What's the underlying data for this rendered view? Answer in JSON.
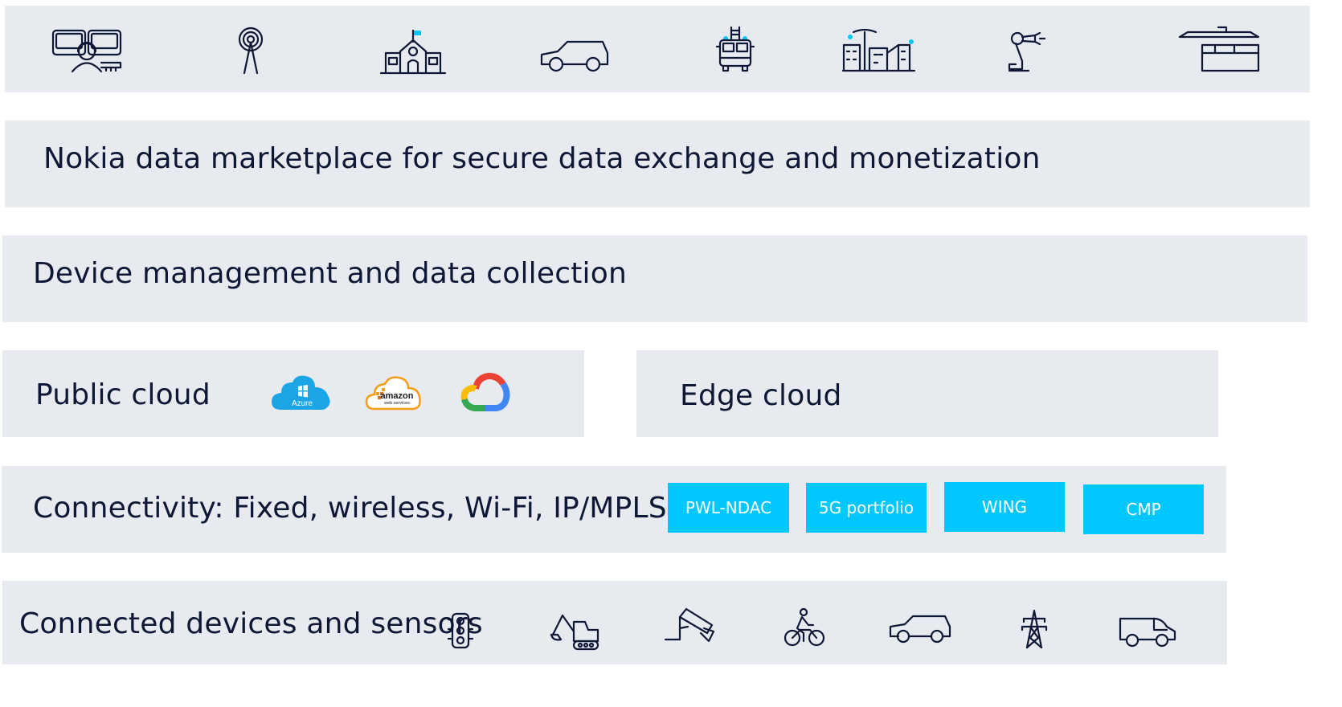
{
  "use_cases": {
    "icons": [
      "headset-operator-icon",
      "radio-tower-icon",
      "school-building-icon",
      "car-icon",
      "fire-truck-icon",
      "smart-city-icon",
      "robot-arm-icon",
      "warehouse-icon"
    ]
  },
  "marketplace": {
    "label": "Nokia data marketplace for secure data exchange and monetization"
  },
  "device_mgmt": {
    "label": "Device management and data collection"
  },
  "public_cloud": {
    "label": "Public cloud",
    "providers": [
      {
        "icon": "azure-cloud-icon",
        "text": "Azure",
        "color": "#1ba4e6"
      },
      {
        "icon": "aws-cloud-icon",
        "text": "amazon",
        "subtext": "web services",
        "color": "#f59c1a"
      },
      {
        "icon": "google-cloud-icon",
        "colors": [
          "#ea4335",
          "#4285f4",
          "#34a853",
          "#fbbc05"
        ]
      }
    ]
  },
  "edge_cloud": {
    "label": "Edge cloud"
  },
  "connectivity": {
    "label": "Connectivity: Fixed, wireless, Wi-Fi, IP/MPLS",
    "chips": [
      "PWL-NDAC",
      "5G portfolio",
      "WING",
      "CMP"
    ],
    "chip_color": "#00c8ff"
  },
  "devices": {
    "label": "Connected devices and sensors",
    "icons": [
      "traffic-light-icon",
      "excavator-icon",
      "cctv-camera-icon",
      "cyclist-icon",
      "car-icon",
      "power-pylon-icon",
      "van-icon"
    ]
  },
  "colors": {
    "band": "#e7ebef",
    "text": "#0f1736",
    "accent": "#00c8ff"
  }
}
